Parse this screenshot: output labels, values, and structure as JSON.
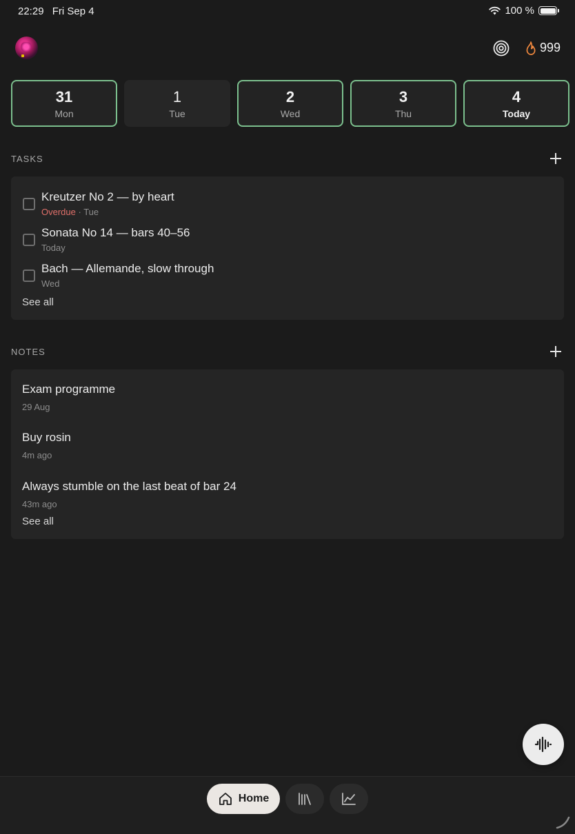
{
  "status_bar": {
    "time": "22:29",
    "date": "Fri Sep 4",
    "battery": "100 %",
    "icons": [
      "wifi-icon",
      "battery-icon"
    ]
  },
  "header": {
    "streak_count": "999",
    "icons": [
      "avatar",
      "target-icon",
      "flame-icon"
    ]
  },
  "days": [
    {
      "num": "31",
      "label": "Mon"
    },
    {
      "num": "1",
      "label": "Tue"
    },
    {
      "num": "2",
      "label": "Wed"
    },
    {
      "num": "3",
      "label": "Thu"
    },
    {
      "num": "4",
      "label": "Today"
    }
  ],
  "tasks": {
    "heading": "TASKS",
    "items": [
      {
        "title": "Kreutzer No 2 — by heart",
        "status": "Overdue",
        "sep": " · ",
        "day": "Tue"
      },
      {
        "title": "Sonata No 14 — bars 40–56",
        "day": "Today"
      },
      {
        "title": "Bach — Allemande, slow through",
        "day": "Wed"
      }
    ],
    "see_all": "See all"
  },
  "notes": {
    "heading": "NOTES",
    "items": [
      {
        "title": "Exam programme",
        "time": "29 Aug"
      },
      {
        "title": "Buy rosin",
        "time": "4m ago"
      },
      {
        "title": "Always stumble on the last beat of bar 24",
        "time": "43m ago"
      }
    ],
    "see_all": "See all"
  },
  "nav": {
    "home_label": "Home",
    "icons": [
      "home-icon",
      "library-icon",
      "stats-icon"
    ]
  },
  "colors": {
    "accent_border": "#7cc08e",
    "overdue": "#e0706a",
    "flame": "#f0883e",
    "background": "#1b1b1b",
    "card": "#252525"
  }
}
